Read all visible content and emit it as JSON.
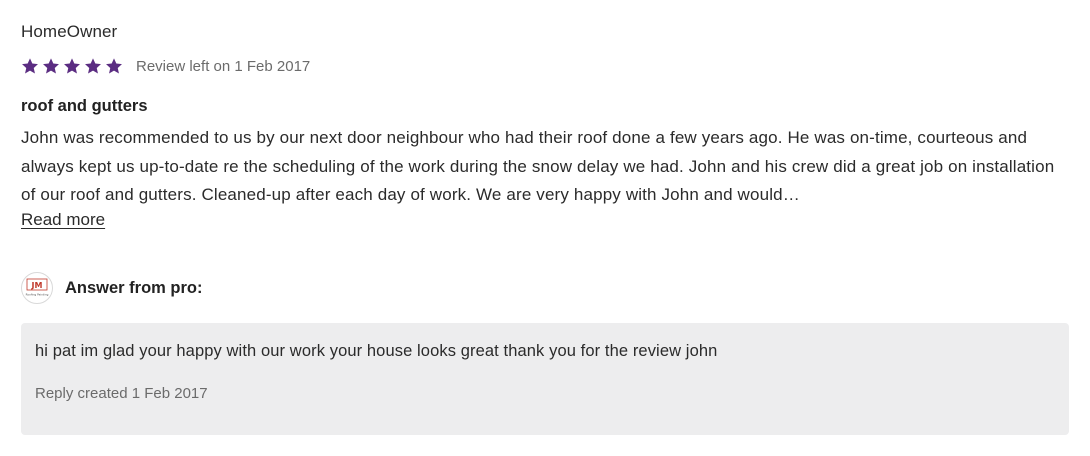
{
  "review": {
    "author": "HomeOwner",
    "rating": 5,
    "rating_max": 5,
    "star_color": "#5b2d82",
    "date_text": "Review left on 1 Feb 2017",
    "title": "roof and gutters",
    "body": "John was recommended to us by our next door neighbour who had their roof done a few years ago. He was on-time, courteous and always kept us up-to-date re the scheduling of the work during the snow delay we had. John and his crew did a great job on installation of our roof and gutters. Cleaned-up after each day of work. We are very happy with John and would…",
    "read_more_label": "Read more"
  },
  "answer": {
    "label": "Answer from pro:",
    "avatar_logo_text": "JM",
    "avatar_logo_subtext": "Roofing Painting",
    "avatar_icon": "company-logo",
    "reply_text": "hi pat im glad your happy with our work your house looks great thank you for the review john",
    "reply_date_text": "Reply created 1 Feb 2017"
  }
}
